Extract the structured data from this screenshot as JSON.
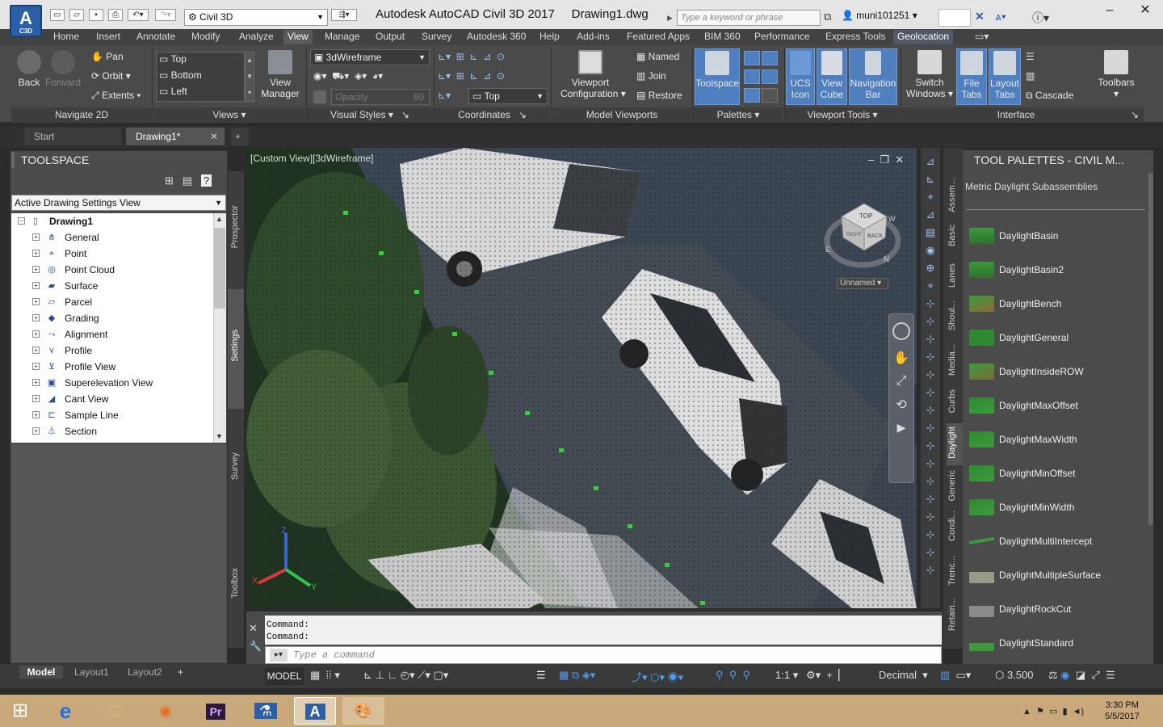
{
  "title_bar": {
    "workspace": "Civil 3D",
    "app_title": "Autodesk AutoCAD Civil 3D 2017",
    "drawing": "Drawing1.dwg",
    "search_placeholder": "Type a keyword or phrase",
    "user": "muni101251",
    "logo_letter": "A",
    "logo_sub": "C3D"
  },
  "menu_tabs": [
    "Home",
    "Insert",
    "Annotate",
    "Modify",
    "Analyze",
    "View",
    "Manage",
    "Output",
    "Survey",
    "Autodesk 360",
    "Help",
    "Add-ins",
    "Featured Apps",
    "BIM 360",
    "Performance",
    "Express Tools",
    "Geolocation"
  ],
  "active_tab": "View",
  "ribbon": {
    "navigate": {
      "back": "Back",
      "forward": "Forward",
      "pan": "Pan",
      "orbit": "Orbit",
      "extents": "Extents",
      "footer": "Navigate 2D"
    },
    "views": {
      "items": [
        "Top",
        "Bottom",
        "Left"
      ],
      "view_manager": "View\nManager",
      "footer": "Views"
    },
    "visual_styles": {
      "style": "3dWireframe",
      "opacity_label": "Opacity",
      "opacity_value": "60",
      "footer": "Visual Styles"
    },
    "coordinates": {
      "view": "Top",
      "footer": "Coordinates"
    },
    "model_viewports": {
      "config": "Viewport\nConfiguration",
      "named": "Named",
      "join": "Join",
      "restore": "Restore",
      "footer": "Model Viewports"
    },
    "palettes": {
      "toolspace": "Toolspace",
      "footer": "Palettes"
    },
    "viewport_tools": {
      "ucs_icon": "UCS\nIcon",
      "view_cube": "View\nCube",
      "navigation_bar": "Navigation\nBar",
      "footer": "Viewport Tools"
    },
    "interface": {
      "switch_windows": "Switch\nWindows",
      "file_tabs": "File\nTabs",
      "layout_tabs": "Layout\nTabs",
      "cascade": "Cascade",
      "toolbars": "Toolbars",
      "footer": "Interface"
    }
  },
  "doc_tabs": {
    "start": "Start",
    "drawing": "Drawing1*"
  },
  "toolspace": {
    "title": "TOOLSPACE",
    "view_combo": "Active Drawing Settings View",
    "root": "Drawing1",
    "items": [
      "General",
      "Point",
      "Point Cloud",
      "Surface",
      "Parcel",
      "Grading",
      "Alignment",
      "Profile",
      "Profile View",
      "Superelevation View",
      "Cant View",
      "Sample Line",
      "Section"
    ],
    "side_tabs": [
      "Prospector",
      "Settings",
      "Survey",
      "Toolbox"
    ]
  },
  "viewport": {
    "label": "[Custom View][3dWireframe]",
    "viewcube": {
      "top": "TOP",
      "back": "BACK",
      "right": "RIGHT",
      "north": "N",
      "east": "E",
      "west": "W"
    },
    "ucs_combo": "Unnamed"
  },
  "command": {
    "history": [
      "Command:",
      "Command:"
    ],
    "placeholder": "Type a command"
  },
  "tool_palettes": {
    "title": "TOOL PALETTES - CIVIL M...",
    "subtitle": "Metric Daylight Subassemblies",
    "items": [
      "DaylightBasin",
      "DaylightBasin2",
      "DaylightBench",
      "DaylightGeneral",
      "DaylightInsideROW",
      "DaylightMaxOffset",
      "DaylightMaxWidth",
      "DaylightMinOffset",
      "DaylightMinWidth",
      "DaylightMultiIntercept",
      "DaylightMultipleSurface",
      "DaylightRockCut",
      "DaylightStandard"
    ],
    "side_tabs": [
      "Assem...",
      "Basic",
      "Lanes",
      "Shoul...",
      "Media...",
      "Curbs",
      "Daylight",
      "Generic",
      "Condi...",
      "Trenc...",
      "Retain..."
    ]
  },
  "status": {
    "layouts": [
      "Model",
      "Layout1",
      "Layout2"
    ],
    "model": "MODEL",
    "scale": "1:1",
    "units": "Decimal",
    "value": "3.500"
  },
  "taskbar": {
    "time": "3:30 PM",
    "date": "5/5/2017"
  },
  "colors": {
    "ribbon": "#4a4a4a",
    "accent": "#4f7fbf",
    "taskbar": "#c9a87c"
  }
}
